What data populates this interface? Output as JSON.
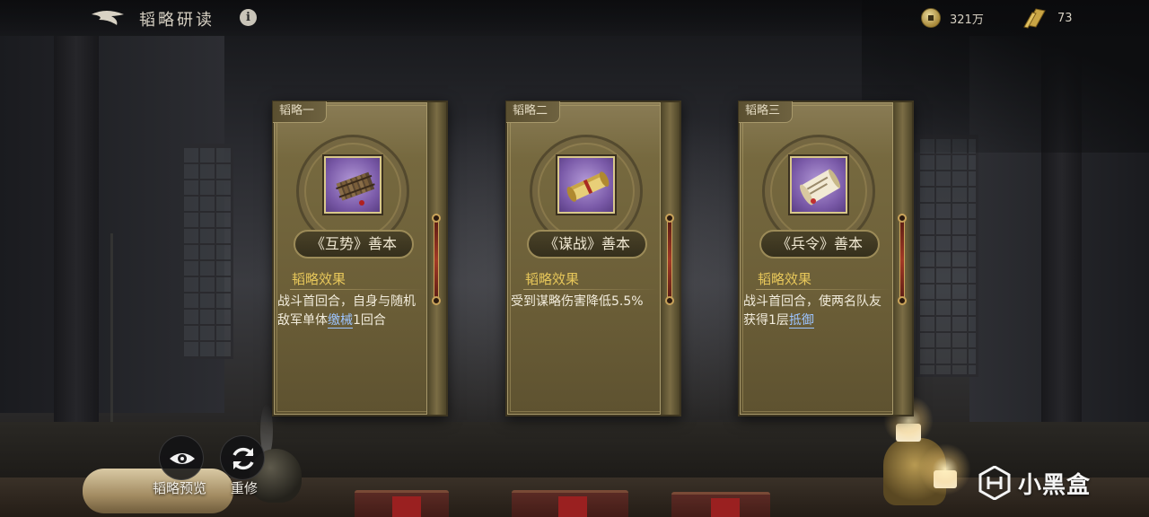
{
  "header": {
    "title": "韬略研读",
    "info_icon": "info-icon",
    "resources": {
      "coins": "321万",
      "tokens": "73"
    }
  },
  "cards": [
    {
      "tab": "韬略一",
      "name": "《互势》善本",
      "effect_label": "韬略效果",
      "desc_before": "战斗首回合，自身与随机敌军单体",
      "desc_keyword": "缴械",
      "desc_after": "1回合",
      "icon": "bamboo-scroll-icon"
    },
    {
      "tab": "韬略二",
      "name": "《谋战》善本",
      "effect_label": "韬略效果",
      "desc_before": "受到谋略伤害降低5.5%",
      "desc_keyword": "",
      "desc_after": "",
      "icon": "yellow-scroll-icon"
    },
    {
      "tab": "韬略三",
      "name": "《兵令》善本",
      "effect_label": "韬略效果",
      "desc_before": "战斗首回合，使两名队友获得1层",
      "desc_keyword": "抵御",
      "desc_after": "",
      "icon": "paper-scroll-icon"
    }
  ],
  "actions": {
    "preview_label": "韬略预览",
    "reset_label": "重修"
  },
  "watermark": {
    "text": "小黑盒"
  },
  "colors": {
    "accent_gold": "#e7c75a",
    "keyword_blue": "#9cc4ff",
    "card_base": "#76693f"
  }
}
